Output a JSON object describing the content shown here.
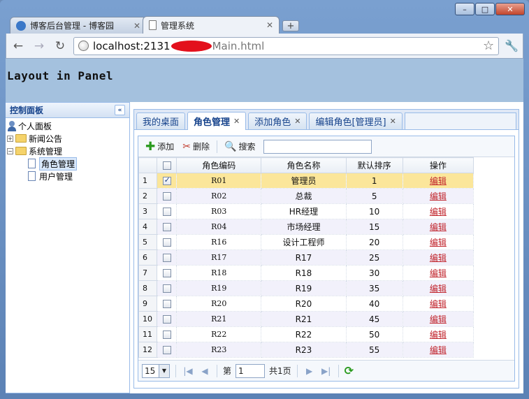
{
  "browser": {
    "tabs": [
      {
        "title": "博客后台管理 - 博客园",
        "active": false
      },
      {
        "title": "管理系统",
        "active": true
      }
    ],
    "new_tab": "+",
    "window_controls": {
      "minimize": "–",
      "maximize": "□",
      "close": "✕"
    },
    "url": {
      "host": "localhost:2131",
      "path": "Main.html"
    }
  },
  "page": {
    "banner_title": "Layout in Panel"
  },
  "west": {
    "title": "控制面板",
    "collapse": "«",
    "tree": {
      "root": "个人面板",
      "news": "新闻公告",
      "system": "系统管理",
      "role_mgmt": "角色管理",
      "user_mgmt": "用户管理"
    }
  },
  "center": {
    "tabs": [
      {
        "label": "我的桌面",
        "closable": false
      },
      {
        "label": "角色管理",
        "closable": true
      },
      {
        "label": "添加角色",
        "closable": true
      },
      {
        "label": "编辑角色[管理员]",
        "closable": true
      }
    ],
    "toolbar": {
      "add": "添加",
      "delete": "删除",
      "search": "搜索",
      "search_value": ""
    },
    "grid": {
      "columns": [
        "角色编码",
        "角色名称",
        "默认排序",
        "操作"
      ],
      "rows": [
        {
          "n": "1",
          "code": "R01",
          "name": "管理员",
          "order": "1",
          "action": "编辑",
          "checked": true
        },
        {
          "n": "2",
          "code": "R02",
          "name": "总裁",
          "order": "5",
          "action": "编辑"
        },
        {
          "n": "3",
          "code": "R03",
          "name": "HR经理",
          "order": "10",
          "action": "编辑"
        },
        {
          "n": "4",
          "code": "R04",
          "name": "市场经理",
          "order": "15",
          "action": "编辑"
        },
        {
          "n": "5",
          "code": "R16",
          "name": "设计工程师",
          "order": "20",
          "action": "编辑"
        },
        {
          "n": "6",
          "code": "R17",
          "name": "R17",
          "order": "25",
          "action": "编辑"
        },
        {
          "n": "7",
          "code": "R18",
          "name": "R18",
          "order": "30",
          "action": "编辑"
        },
        {
          "n": "8",
          "code": "R19",
          "name": "R19",
          "order": "35",
          "action": "编辑"
        },
        {
          "n": "9",
          "code": "R20",
          "name": "R20",
          "order": "40",
          "action": "编辑"
        },
        {
          "n": "10",
          "code": "R21",
          "name": "R21",
          "order": "45",
          "action": "编辑"
        },
        {
          "n": "11",
          "code": "R22",
          "name": "R22",
          "order": "50",
          "action": "编辑"
        },
        {
          "n": "12",
          "code": "R23",
          "name": "R23",
          "order": "55",
          "action": "编辑"
        }
      ]
    },
    "pager": {
      "page_size": "15",
      "page_label_before": "第",
      "page_value": "1",
      "page_label_after": "共1页"
    }
  }
}
